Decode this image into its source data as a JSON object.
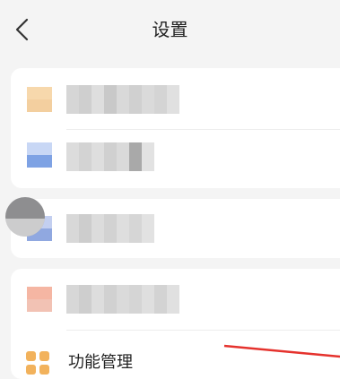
{
  "header": {
    "back_icon": "chevron-left-icon",
    "title": "设置"
  },
  "group1": {
    "rows": [
      "blurred-row-1",
      "blurred-row-2"
    ]
  },
  "group2": {
    "rows": [
      "blurred-row-3"
    ]
  },
  "group3": {
    "feature_management": {
      "label": "功能管理",
      "icon": "grid-icon",
      "icon_color": "#f2b25c"
    }
  },
  "annotation": {
    "color": "#e5322d"
  }
}
